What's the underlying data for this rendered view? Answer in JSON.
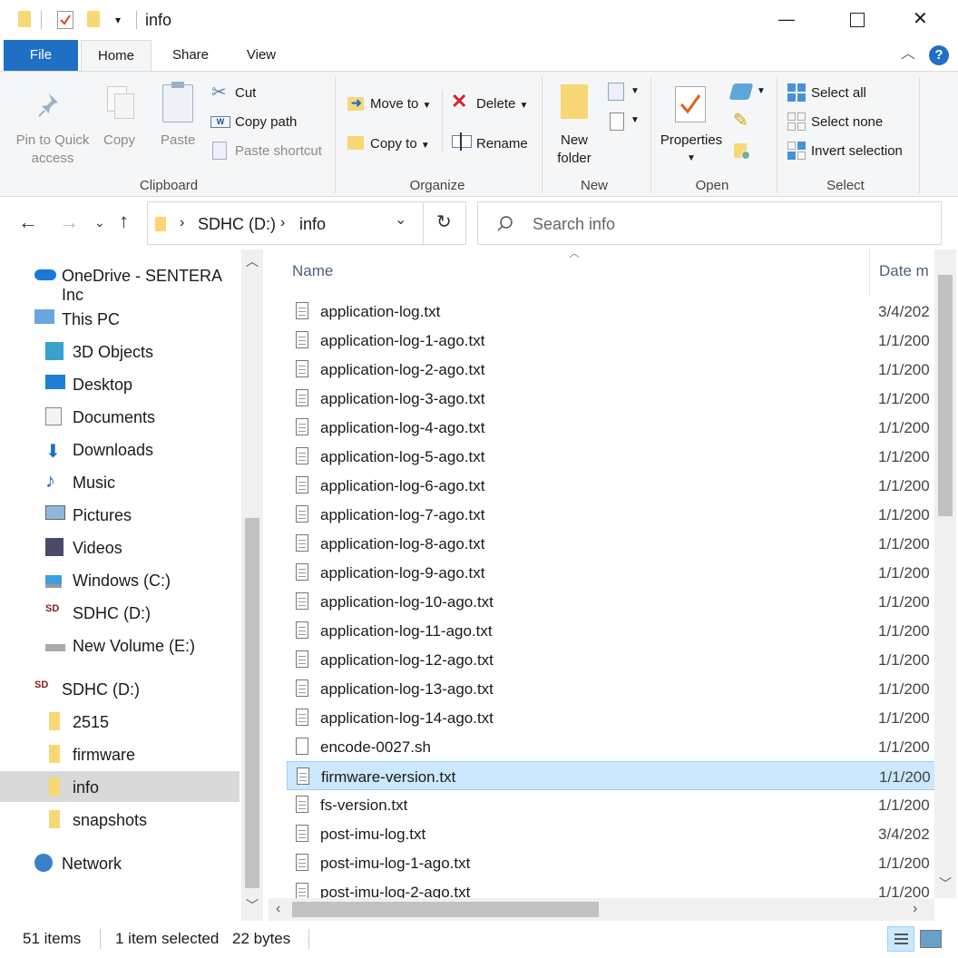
{
  "window": {
    "title": "info",
    "controls": {
      "minimize": "—",
      "maximize": "☐",
      "close": "✕"
    }
  },
  "tabs": {
    "file": "File",
    "home": "Home",
    "share": "Share",
    "view": "View",
    "help": "?"
  },
  "ribbon": {
    "clipboard": {
      "pin_line1": "Pin to Quick",
      "pin_line2": "access",
      "copy": "Copy",
      "paste": "Paste",
      "cut": "Cut",
      "copy_path": "Copy path",
      "paste_shortcut": "Paste shortcut",
      "label": "Clipboard"
    },
    "organize": {
      "move_to": "Move to",
      "copy_to": "Copy to",
      "delete": "Delete",
      "rename": "Rename",
      "label": "Organize"
    },
    "new": {
      "new_folder_line1": "New",
      "new_folder_line2": "folder",
      "label": "New"
    },
    "open": {
      "properties": "Properties",
      "label": "Open"
    },
    "select": {
      "select_all": "Select all",
      "select_none": "Select none",
      "invert": "Invert selection",
      "label": "Select"
    }
  },
  "address": {
    "crumbs": [
      "SDHC (D:)",
      "info"
    ],
    "search_placeholder": "Search info"
  },
  "nav": {
    "items": [
      {
        "label": "OneDrive - SENTERA Inc",
        "icon": "onedrive-cloud-icon"
      },
      {
        "label": "This PC",
        "icon": "computer-icon"
      },
      {
        "label": "3D Objects",
        "icon": "cube-icon"
      },
      {
        "label": "Desktop",
        "icon": "desktop-icon"
      },
      {
        "label": "Documents",
        "icon": "documents-icon"
      },
      {
        "label": "Downloads",
        "icon": "download-arrow-icon"
      },
      {
        "label": "Music",
        "icon": "music-note-icon"
      },
      {
        "label": "Pictures",
        "icon": "pictures-icon"
      },
      {
        "label": "Videos",
        "icon": "film-icon"
      },
      {
        "label": "Windows (C:)",
        "icon": "windows-drive-icon"
      },
      {
        "label": "SDHC (D:)",
        "icon": "sdhc-card-icon"
      },
      {
        "label": "New Volume (E:)",
        "icon": "drive-icon"
      },
      {
        "label": "SDHC (D:)",
        "icon": "sdhc-card-icon"
      },
      {
        "label": "2515",
        "icon": "folder-icon"
      },
      {
        "label": "firmware",
        "icon": "folder-icon"
      },
      {
        "label": "info",
        "icon": "folder-icon"
      },
      {
        "label": "snapshots",
        "icon": "folder-icon"
      },
      {
        "label": "Network",
        "icon": "network-icon"
      }
    ]
  },
  "files": {
    "columns": {
      "name": "Name",
      "date": "Date m"
    },
    "rows": [
      {
        "name": "application-log.txt",
        "date": "3/4/202"
      },
      {
        "name": "application-log-1-ago.txt",
        "date": "1/1/200"
      },
      {
        "name": "application-log-2-ago.txt",
        "date": "1/1/200"
      },
      {
        "name": "application-log-3-ago.txt",
        "date": "1/1/200"
      },
      {
        "name": "application-log-4-ago.txt",
        "date": "1/1/200"
      },
      {
        "name": "application-log-5-ago.txt",
        "date": "1/1/200"
      },
      {
        "name": "application-log-6-ago.txt",
        "date": "1/1/200"
      },
      {
        "name": "application-log-7-ago.txt",
        "date": "1/1/200"
      },
      {
        "name": "application-log-8-ago.txt",
        "date": "1/1/200"
      },
      {
        "name": "application-log-9-ago.txt",
        "date": "1/1/200"
      },
      {
        "name": "application-log-10-ago.txt",
        "date": "1/1/200"
      },
      {
        "name": "application-log-11-ago.txt",
        "date": "1/1/200"
      },
      {
        "name": "application-log-12-ago.txt",
        "date": "1/1/200"
      },
      {
        "name": "application-log-13-ago.txt",
        "date": "1/1/200"
      },
      {
        "name": "application-log-14-ago.txt",
        "date": "1/1/200"
      },
      {
        "name": "encode-0027.sh",
        "date": "1/1/200"
      },
      {
        "name": "firmware-version.txt",
        "date": "1/1/200"
      },
      {
        "name": "fs-version.txt",
        "date": "1/1/200"
      },
      {
        "name": "post-imu-log.txt",
        "date": "3/4/202"
      },
      {
        "name": "post-imu-log-1-ago.txt",
        "date": "1/1/200"
      },
      {
        "name": "post-imu-log-2-ago.txt",
        "date": "1/1/200"
      }
    ],
    "selected_index": 16
  },
  "status": {
    "count": "51 items",
    "selected": "1 item selected",
    "size": "22 bytes"
  },
  "colors": {
    "file_tab": "#1f6fc5",
    "selection": "#cce8ff",
    "folder": "#f8d775"
  }
}
